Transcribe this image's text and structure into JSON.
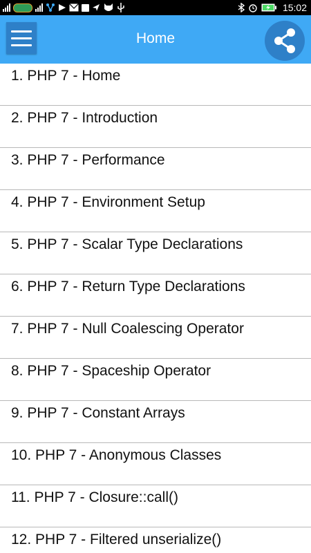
{
  "status_bar": {
    "time": "15:02"
  },
  "app_bar": {
    "title": "Home",
    "menu_icon": "hamburger-menu-icon",
    "share_icon": "share-icon",
    "color": "#3fa9f5"
  },
  "list": {
    "items": [
      {
        "label": "1. PHP 7 - Home"
      },
      {
        "label": "2. PHP 7 - Introduction"
      },
      {
        "label": "3. PHP 7 - Performance"
      },
      {
        "label": "4. PHP 7 - Environment Setup"
      },
      {
        "label": "5. PHP 7 - Scalar Type Declarations"
      },
      {
        "label": "6. PHP 7 - Return Type Declarations"
      },
      {
        "label": "7. PHP 7 - Null Coalescing Operator"
      },
      {
        "label": "8. PHP 7 - Spaceship Operator"
      },
      {
        "label": "9. PHP 7 - Constant Arrays"
      },
      {
        "label": "10. PHP 7 - Anonymous Classes"
      },
      {
        "label": "11. PHP 7 - Closure::call()"
      },
      {
        "label": "12. PHP 7 - Filtered unserialize()"
      }
    ]
  }
}
